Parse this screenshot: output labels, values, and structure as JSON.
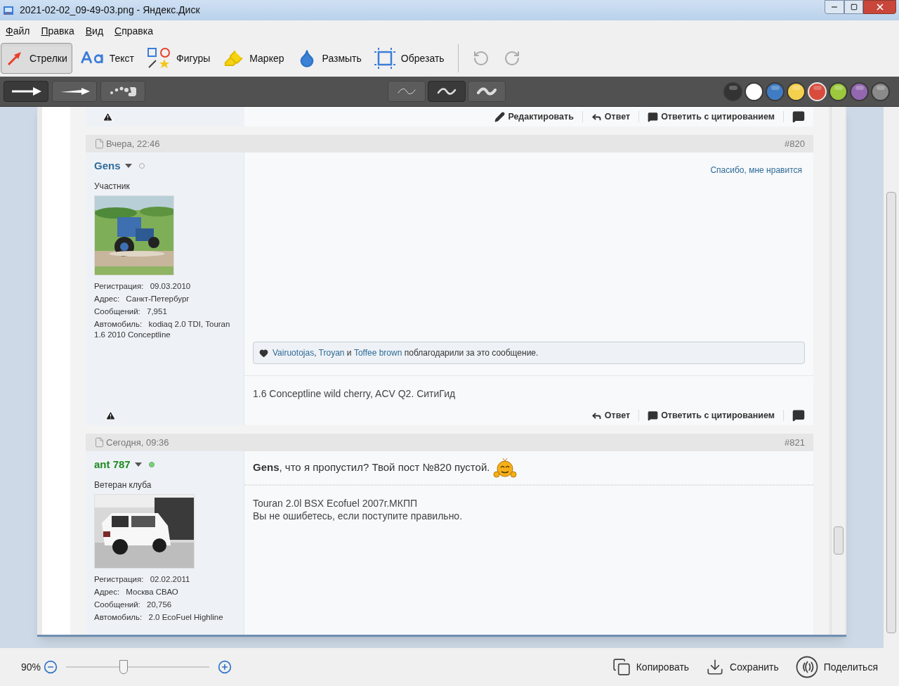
{
  "window": {
    "title": "2021-02-02_09-49-03.png - Яндекс.Диск"
  },
  "menu": [
    {
      "label": "Файл"
    },
    {
      "label": "Правка"
    },
    {
      "label": "Вид"
    },
    {
      "label": "Справка"
    }
  ],
  "tools": [
    {
      "label": "Стрелки",
      "selected": true
    },
    {
      "label": "Текст",
      "selected": false
    },
    {
      "label": "Фигуры",
      "selected": false
    },
    {
      "label": "Маркер",
      "selected": false
    },
    {
      "label": "Размыть",
      "selected": false
    },
    {
      "label": "Обрезать",
      "selected": false
    }
  ],
  "arrow_styles": [
    {
      "selected": true
    },
    {
      "selected": false
    },
    {
      "selected": false
    }
  ],
  "line_widths": [
    {
      "selected": false
    },
    {
      "selected": true
    },
    {
      "selected": false
    }
  ],
  "colors": [
    {
      "color": "#333333",
      "selected": false
    },
    {
      "color": "#ffffff",
      "selected": false
    },
    {
      "color": "#3f7cc4",
      "selected": false
    },
    {
      "color": "#f5d04c",
      "selected": false
    },
    {
      "color": "#d94b3d",
      "selected": true
    },
    {
      "color": "#9bc83c",
      "selected": false
    },
    {
      "color": "#9468b0",
      "selected": false
    },
    {
      "color": "#8a8a8a",
      "selected": false
    }
  ],
  "forum": {
    "top_footer": [
      {
        "kind": "edit",
        "label": "Редактировать"
      },
      {
        "kind": "reply",
        "label": "Ответ"
      },
      {
        "kind": "quote",
        "label": "Ответить с цитированием"
      }
    ],
    "posts": [
      {
        "date": "Вчера, 22:46",
        "number": "#820",
        "user": {
          "name": "Gens",
          "color": "#2f6b98",
          "online": false,
          "role": "Участник",
          "details": [
            {
              "label": "Регистрация:",
              "value": "09.03.2010"
            },
            {
              "label": "Адрес:",
              "value": "Санкт-Петербург"
            },
            {
              "label": "Сообщений:",
              "value": "7,951"
            },
            {
              "label": "Автомобиль:",
              "value": "kodiaq 2.0 TDI, Touran 1.6 2010 Conceptline"
            }
          ]
        },
        "like_link": "Спасибо, мне нравится",
        "thanks": [
          {
            "kind": "link",
            "text": "Vairuotojas"
          },
          {
            "kind": "plain",
            "text": ", "
          },
          {
            "kind": "link",
            "text": "Troyan"
          },
          {
            "kind": "plain",
            "text": " и "
          },
          {
            "kind": "link",
            "text": "Toffee brown"
          },
          {
            "kind": "plain",
            "text": " поблагодарили за это сообщение."
          }
        ],
        "signature": [
          "1.6 Conceptline wild cherry, ACV Q2. СитиГид"
        ],
        "footer": [
          {
            "kind": "reply",
            "label": "Ответ"
          },
          {
            "kind": "quote",
            "label": "Ответить с цитированием"
          }
        ]
      },
      {
        "date": "Сегодня, 09:36",
        "number": "#821",
        "user": {
          "name": "ant 787",
          "color": "#1f8a1f",
          "online": true,
          "role": "Ветеран клуба",
          "details": [
            {
              "label": "Регистрация:",
              "value": "02.02.2011"
            },
            {
              "label": "Адрес:",
              "value": "Москва СВАО"
            },
            {
              "label": "Сообщений:",
              "value": "20,756"
            },
            {
              "label": "Автомобиль:",
              "value": "2.0 EcoFuel Highline"
            }
          ]
        },
        "message": "**Gens**, что я пропустил? Твой пост №820 пустой.",
        "emoticon": true,
        "signature": [
          "Touran 2.0l BSX Ecofuel 2007г.МКПП",
          "Вы не ошибетесь, если поступите правильно."
        ]
      }
    ]
  },
  "zoom": {
    "reading": "90%",
    "level": 0.4
  },
  "actions": [
    {
      "kind": "copy",
      "label": "Копировать"
    },
    {
      "kind": "save",
      "label": "Сохранить"
    },
    {
      "kind": "share",
      "label": "Поделиться"
    }
  ]
}
